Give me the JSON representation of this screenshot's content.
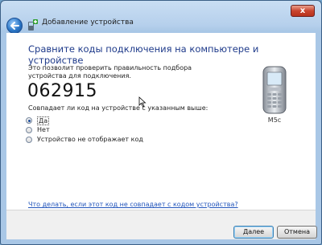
{
  "window": {
    "title": "Добавление устройства",
    "close_symbol": "x"
  },
  "main": {
    "heading": "Сравните коды подключения на компьютере и устройстве",
    "description": "Это позволит проверить правильность подбора устройства для подключения.",
    "code": "062915",
    "question": "Совпадает ли код на устройстве с указанным выше:",
    "options": [
      {
        "label": "Да",
        "checked": true
      },
      {
        "label": "Нет",
        "checked": false
      },
      {
        "label": "Устройство не отображает код",
        "checked": false
      }
    ],
    "device_name": "M5c",
    "help_link": "Что делать, если этот код не совпадает с кодом устройства?"
  },
  "footer": {
    "next_label": "Далее",
    "cancel_label": "Отмена"
  },
  "icons": {
    "back": "back-arrow-icon",
    "title": "bluetooth-device-add-icon",
    "device": "mobile-phone-icon"
  }
}
